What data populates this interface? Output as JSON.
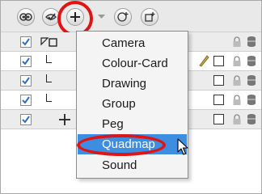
{
  "toolbar": {
    "buttons": [
      {
        "name": "show-all-toggle",
        "icon": "eyes-icon"
      },
      {
        "name": "enable-toggle",
        "icon": "eye-check-icon"
      },
      {
        "name": "add-element-button",
        "icon": "plus-icon"
      },
      {
        "name": "dropdown-arrow",
        "icon": "chevron-down-icon"
      },
      {
        "name": "add-drawing-button",
        "icon": "add-drawing-icon"
      },
      {
        "name": "add-peg-button",
        "icon": "add-peg-icon"
      }
    ]
  },
  "layers": [
    {
      "checked": true,
      "type": "header"
    },
    {
      "checked": true,
      "type": "child",
      "has_pencil": true
    },
    {
      "checked": true,
      "type": "child",
      "has_pencil": false
    },
    {
      "checked": true,
      "type": "child",
      "has_pencil": false
    },
    {
      "checked": true,
      "type": "add"
    }
  ],
  "add_menu": {
    "items": [
      {
        "label": "Camera",
        "highlighted": false
      },
      {
        "label": "Colour-Card",
        "highlighted": false
      },
      {
        "label": "Drawing",
        "highlighted": false
      },
      {
        "label": "Group",
        "highlighted": false
      },
      {
        "label": "Peg",
        "highlighted": false
      },
      {
        "label": "Quadmap",
        "highlighted": true
      },
      {
        "label": "Sound",
        "highlighted": false
      }
    ]
  },
  "colors": {
    "highlight": "#3d8ee0",
    "annotation_red": "#e21313",
    "check_blue": "#2a6fc9"
  }
}
